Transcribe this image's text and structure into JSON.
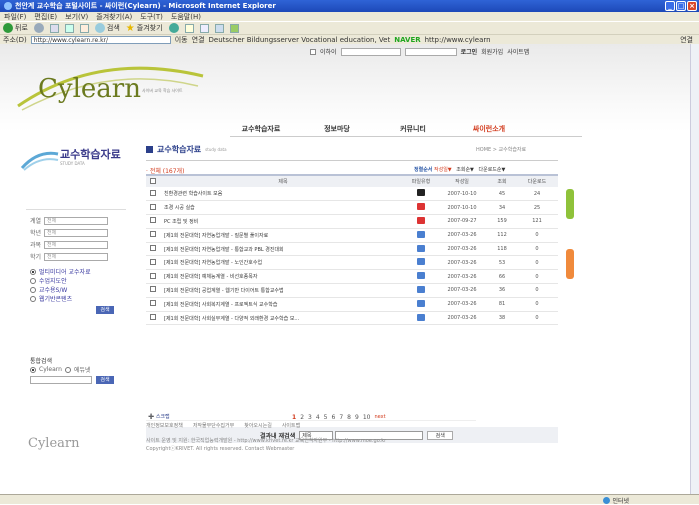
{
  "window": {
    "title": "천안계 교수학습 포털사이트 - 싸이런(Cylearn) - Microsoft Internet Explorer"
  },
  "menu": [
    "파일(F)",
    "편집(E)",
    "보기(V)",
    "즐겨찾기(A)",
    "도구(T)",
    "도움말(H)"
  ],
  "toolbar": {
    "back": "뒤로",
    "search": "검색",
    "favorites": "즐겨찾기"
  },
  "addressbar": {
    "label": "주소(D)",
    "url": "http://www.cylearn.re.kr/",
    "go": "이동",
    "links_label": "연결",
    "link1": "Deutscher Bildungsserver Vocational education, Vet",
    "naver": "NAVER",
    "link2": "http://www.cylearn",
    "links": "연결"
  },
  "page": {
    "util": {
      "search_placeholder": "이하이",
      "login": "로그인",
      "join": "회원가입",
      "sitemap": "사이트맵"
    },
    "logo": {
      "text": "Cylearn",
      "tagline": "사이버 교육 학습 사이트"
    },
    "gnb": [
      "교수학습자료",
      "정보마당",
      "커뮤니티",
      "싸이런소개"
    ],
    "lnb": {
      "title": "교수학습자료",
      "subtitle": "STUDY DATA",
      "filters": [
        {
          "label": "계열",
          "value": "전체"
        },
        {
          "label": "학년",
          "value": "전체"
        },
        {
          "label": "과목",
          "value": "전체"
        },
        {
          "label": "학기",
          "value": "전체"
        }
      ],
      "types": [
        "멀티미디어 교수자료",
        "수업지도안",
        "교수용S/W",
        "웹기반콘텐츠"
      ],
      "search_btn": "검색",
      "integrated_title": "통합검색",
      "integrated_options": [
        "Cylearn",
        "에듀넷"
      ],
      "integrated_btn": "검색"
    },
    "content": {
      "title": "교수학습자료",
      "title_sub": "study data",
      "breadcrumb": "HOME > 교수학습자료",
      "total": "· 전체 (167개)",
      "sort_label": "정렬순서",
      "sort": [
        "작성일▼",
        "조회순▼",
        "다운로드순▼"
      ],
      "headers": [
        "",
        "제목",
        "파일유형",
        "작성일",
        "조회",
        "다운로드"
      ],
      "rows": [
        {
          "title": "친환경관련 학습사이트 모음",
          "date": "2007-10-10",
          "views": "45",
          "downloads": "24",
          "ftype": "black"
        },
        {
          "title": "조경 시공 실습",
          "date": "2007-10-10",
          "views": "34",
          "downloads": "25",
          "ftype": "red"
        },
        {
          "title": "PC 조립 및 정비",
          "date": "2007-09-27",
          "views": "159",
          "downloads": "121",
          "ftype": "red"
        },
        {
          "title": "[제1회 전문대학] 자연농업개발 - 질문별 풀이자료",
          "date": "2007-03-26",
          "views": "112",
          "downloads": "0",
          "ftype": "blue"
        },
        {
          "title": "[제1회 전문대학] 자연농업개발 - 통합교과 PBL 경진대회",
          "date": "2007-03-26",
          "views": "118",
          "downloads": "0",
          "ftype": "blue"
        },
        {
          "title": "[제1회 전문대학] 자연농업개발 - 노인간호수업",
          "date": "2007-03-26",
          "views": "53",
          "downloads": "0",
          "ftype": "blue"
        },
        {
          "title": "[제1회 전문대학] 예체능계열 - 비선호종목자",
          "date": "2007-03-26",
          "views": "66",
          "downloads": "0",
          "ftype": "blue"
        },
        {
          "title": "[제1회 전문대학] 공업계열 - 웹기반 다이어트 통합교수법",
          "date": "2007-03-26",
          "views": "36",
          "downloads": "0",
          "ftype": "blue"
        },
        {
          "title": "[제1회 전문대학] 사회복지계열 - 프로젝트식 교수학습",
          "date": "2007-03-26",
          "views": "81",
          "downloads": "0",
          "ftype": "blue"
        },
        {
          "title": "[제1회 전문대학] 사회실무계열 - 다양적 외래환경 교수학습 모...",
          "date": "2007-03-26",
          "views": "38",
          "downloads": "0",
          "ftype": "blue"
        }
      ],
      "list_btn": "스크랩",
      "pages": [
        "1",
        "2",
        "3",
        "4",
        "5",
        "6",
        "7",
        "8",
        "9",
        "10"
      ],
      "next": "next",
      "search_label": "결과내 재검색",
      "search_option": "제목",
      "search_btn": "검색"
    },
    "footer": {
      "links": [
        "개인정보보호정책",
        "저작물무단수집거부",
        "찾아오시는길",
        "사이트맵"
      ],
      "logo": "Cylearn",
      "line1": "사이트 운영 및 지원: 한국직업능력개발원 - http://www.krivet.re.kr  교육인적자원부 - http://www.moe.go.kr",
      "line2": "CopyrightⓒKRIVET. All rights reserved. Contact Webmaster"
    }
  },
  "status": {
    "left": "",
    "zone": "인터넷"
  }
}
